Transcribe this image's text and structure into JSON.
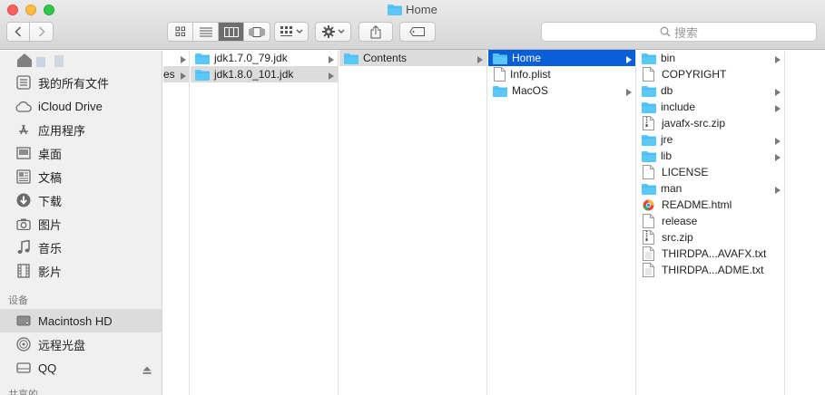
{
  "window": {
    "title": "Home"
  },
  "toolbar": {
    "search_placeholder": "搜索"
  },
  "sidebar": {
    "favorites": [
      {
        "label": "我的所有文件",
        "icon": "all-files-icon"
      },
      {
        "label": "iCloud Drive",
        "icon": "cloud-icon"
      },
      {
        "label": "应用程序",
        "icon": "applications-icon"
      },
      {
        "label": "桌面",
        "icon": "desktop-icon"
      },
      {
        "label": "文稿",
        "icon": "documents-icon"
      },
      {
        "label": "下载",
        "icon": "downloads-icon"
      },
      {
        "label": "图片",
        "icon": "camera-icon"
      },
      {
        "label": "音乐",
        "icon": "music-icon"
      },
      {
        "label": "影片",
        "icon": "film-icon"
      }
    ],
    "devices_header": "设备",
    "devices": [
      {
        "label": "Macintosh HD",
        "icon": "harddisk-icon"
      },
      {
        "label": "远程光盘",
        "icon": "disc-icon"
      },
      {
        "label": "QQ",
        "icon": "drive-icon"
      }
    ],
    "shared_header": "共享的"
  },
  "columns": {
    "col0": {
      "partial": "es"
    },
    "col1": [
      {
        "name": "jdk1.7.0_79.jdk",
        "type": "folder"
      },
      {
        "name": "jdk1.8.0_101.jdk",
        "type": "folder"
      }
    ],
    "col2": [
      {
        "name": "Contents",
        "type": "folder"
      }
    ],
    "col3": [
      {
        "name": "Home",
        "type": "folder"
      },
      {
        "name": "Info.plist",
        "type": "file"
      },
      {
        "name": "MacOS",
        "type": "folder"
      }
    ],
    "col4": [
      {
        "name": "bin",
        "type": "folder"
      },
      {
        "name": "COPYRIGHT",
        "type": "file"
      },
      {
        "name": "db",
        "type": "folder"
      },
      {
        "name": "include",
        "type": "folder"
      },
      {
        "name": "javafx-src.zip",
        "type": "zip"
      },
      {
        "name": "jre",
        "type": "folder"
      },
      {
        "name": "lib",
        "type": "folder"
      },
      {
        "name": "LICENSE",
        "type": "file"
      },
      {
        "name": "man",
        "type": "folder"
      },
      {
        "name": "README.html",
        "type": "html"
      },
      {
        "name": "release",
        "type": "file"
      },
      {
        "name": "src.zip",
        "type": "zip"
      },
      {
        "name": "THIRDPA...AVAFX.txt",
        "type": "txt"
      },
      {
        "name": "THIRDPA...ADME.txt",
        "type": "txt"
      }
    ]
  },
  "colors": {
    "accent": "#0a5fd8",
    "folder": "#5ac8fa"
  }
}
